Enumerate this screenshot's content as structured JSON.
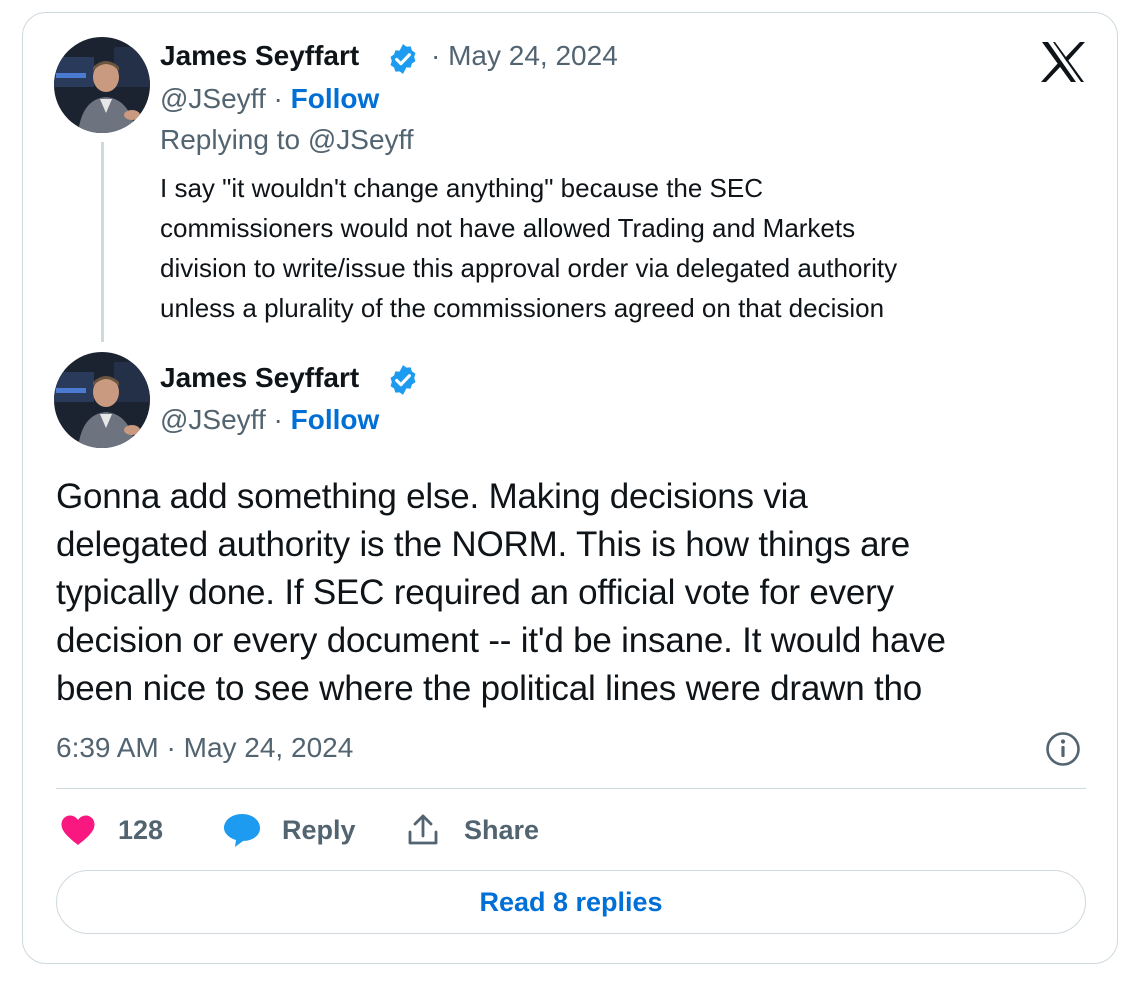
{
  "reply_tweet": {
    "author_name": "James Seyffart",
    "separator": "·",
    "date": "May 24, 2024",
    "handle": "@JSeyff",
    "follow_label": "Follow",
    "replying_to": "Replying to @JSeyff",
    "text_lines": [
      "I say \"it wouldn't change anything\" because the SEC",
      "commissioners would not have allowed Trading and Markets",
      "division to write/issue this approval order via delegated authority",
      "unless a plurality of the commissioners agreed on that decision"
    ]
  },
  "main_tweet": {
    "author_name": "James Seyffart",
    "handle": "@JSeyff",
    "separator": "·",
    "follow_label": "Follow",
    "text_lines": [
      "Gonna add something else. Making decisions via",
      "delegated authority is the NORM. This is how things are",
      "typically done. If SEC required an official vote for every",
      "decision or every document -- it'd be insane. It would have",
      "been nice to see where the political lines were drawn tho"
    ],
    "timestamp": "6:39 AM · May 24, 2024"
  },
  "actions": {
    "like_count": "128",
    "reply_label": "Reply",
    "share_label": "Share"
  },
  "read_replies_label": "Read 8 replies",
  "icons": {
    "logo": "x-logo-icon",
    "verified": "verified-badge-icon",
    "info": "info-icon",
    "like": "heart-icon",
    "reply": "speech-bubble-icon",
    "share": "share-icon"
  },
  "colors": {
    "link_blue": "#006fd6",
    "verified_blue": "#1d9bf0",
    "heart_pink": "#f91880",
    "muted_gray": "#536471",
    "border": "#cfd9de"
  }
}
